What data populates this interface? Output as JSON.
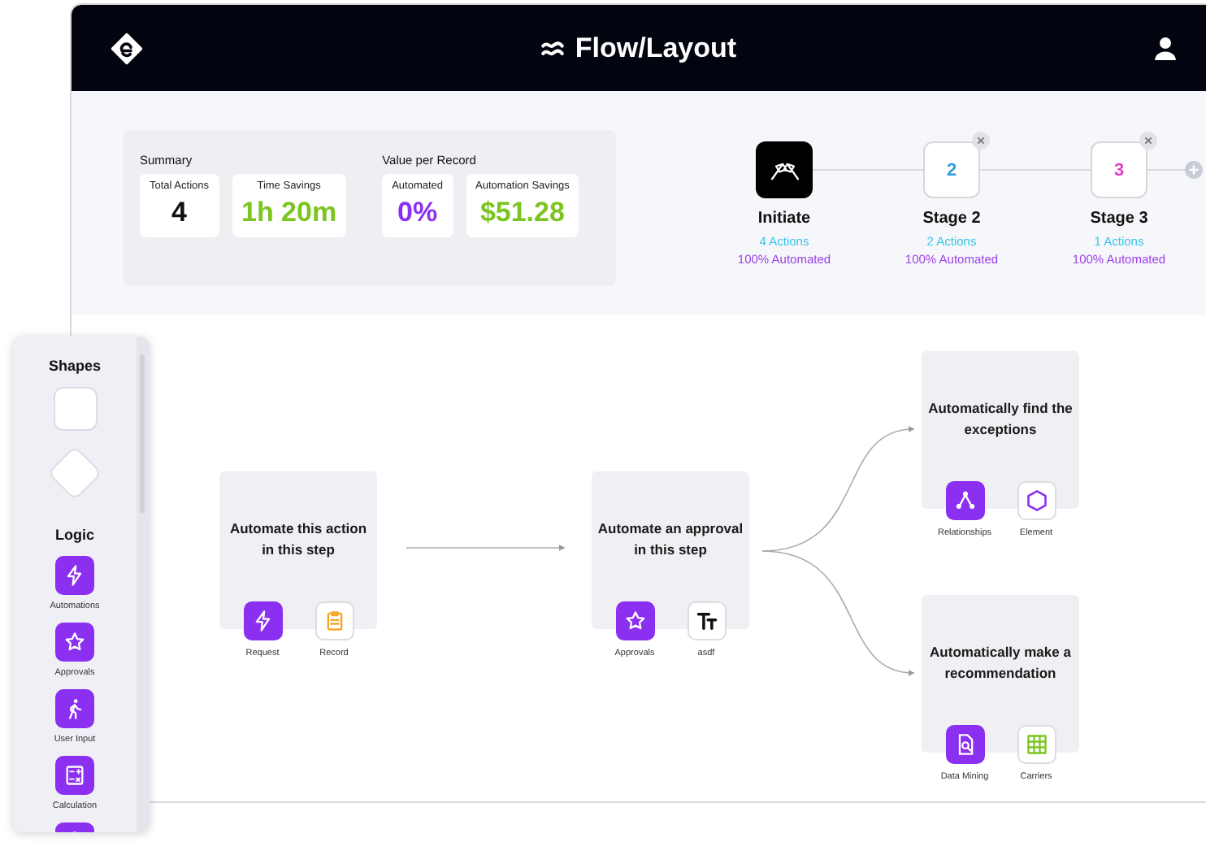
{
  "header": {
    "title": "Flow/Layout"
  },
  "summary": {
    "groups": [
      {
        "title": "Summary",
        "tiles": [
          {
            "label": "Total Actions",
            "value": "4",
            "color": "#111111"
          },
          {
            "label": "Time Savings",
            "value": "1h 20m",
            "color": "#7cc520"
          }
        ]
      },
      {
        "title": "Value per Record",
        "tiles": [
          {
            "label": "Automated",
            "value": "0%",
            "color": "#8b2ff0"
          },
          {
            "label": "Automation Savings",
            "value": "$51.28",
            "color": "#7cc520"
          }
        ]
      }
    ]
  },
  "stages": [
    {
      "kind": "start",
      "name": "Initiate",
      "actions": "4 Actions",
      "automated": "100% Automated",
      "removable": false
    },
    {
      "kind": "numbered",
      "number": "2",
      "color": "#2f9be0",
      "name": "Stage 2",
      "actions": "2 Actions",
      "automated": "100% Automated",
      "removable": true
    },
    {
      "kind": "numbered",
      "number": "3",
      "color": "#e03fc4",
      "name": "Stage 3",
      "actions": "1 Actions",
      "automated": "100% Automated",
      "removable": true
    }
  ],
  "palette": {
    "sections": [
      {
        "title": "Shapes",
        "items": [
          {
            "kind": "square"
          },
          {
            "kind": "diamond"
          }
        ]
      },
      {
        "title": "Logic",
        "items": [
          {
            "kind": "tool",
            "label": "Automations"
          },
          {
            "kind": "tool",
            "label": "Approvals"
          },
          {
            "kind": "tool",
            "label": "User Input"
          },
          {
            "kind": "tool",
            "label": "Calculation"
          },
          {
            "kind": "tool"
          }
        ]
      }
    ]
  },
  "flow": {
    "nodes": [
      {
        "text": "Automate this action in this step",
        "actions": [
          {
            "kind": "filled",
            "label": "Request"
          },
          {
            "kind": "outline",
            "label": "Record"
          }
        ]
      },
      {
        "text": "Automate an approval in this step",
        "actions": [
          {
            "kind": "filled",
            "label": "Approvals"
          },
          {
            "kind": "outline",
            "label": "asdf"
          }
        ]
      },
      {
        "text": "Automatically find the exceptions",
        "actions": [
          {
            "kind": "filled",
            "label": "Relationships"
          },
          {
            "kind": "outline",
            "label": "Element"
          }
        ]
      },
      {
        "text": "Automatically make a recommendation",
        "actions": [
          {
            "kind": "filled",
            "label": "Data Mining"
          },
          {
            "kind": "outline",
            "label": "Carriers"
          }
        ]
      }
    ]
  }
}
